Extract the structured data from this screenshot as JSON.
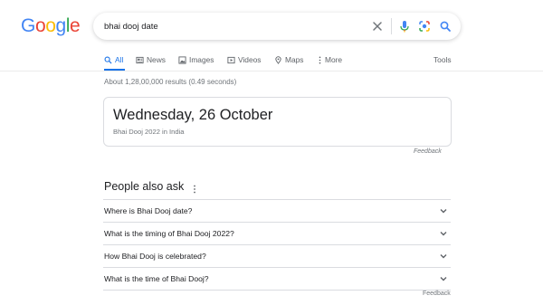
{
  "logo": {
    "letters": [
      {
        "ch": "G",
        "color": "#4285F4"
      },
      {
        "ch": "o",
        "color": "#EA4335"
      },
      {
        "ch": "o",
        "color": "#FBBC05"
      },
      {
        "ch": "g",
        "color": "#4285F4"
      },
      {
        "ch": "l",
        "color": "#34A853"
      },
      {
        "ch": "e",
        "color": "#EA4335"
      }
    ]
  },
  "search": {
    "query": "bhai dooj date",
    "icons": [
      "clear-icon",
      "mic-icon",
      "lens-icon",
      "search-icon"
    ]
  },
  "tabs": {
    "all": "All",
    "news": "News",
    "images": "Images",
    "videos": "Videos",
    "maps": "Maps",
    "more": "More",
    "tools": "Tools"
  },
  "result_stats": "About 1,28,00,000 results (0.49 seconds)",
  "answer": {
    "title": "Wednesday, 26 October",
    "subtitle": "Bhai Dooj 2022 in India",
    "feedback": "Feedback"
  },
  "people_also_ask": {
    "title": "People also ask",
    "questions": [
      "Where is Bhai Dooj date?",
      "What is the timing of Bhai Dooj 2022?",
      "How Bhai Dooj is celebrated?",
      "What is the time of Bhai Dooj?"
    ],
    "feedback": "Feedback"
  },
  "colors": {
    "accent": "#1a73e8",
    "text": "#202124",
    "secondary": "#5f6368",
    "muted": "#70757a",
    "border": "#dadce0"
  }
}
